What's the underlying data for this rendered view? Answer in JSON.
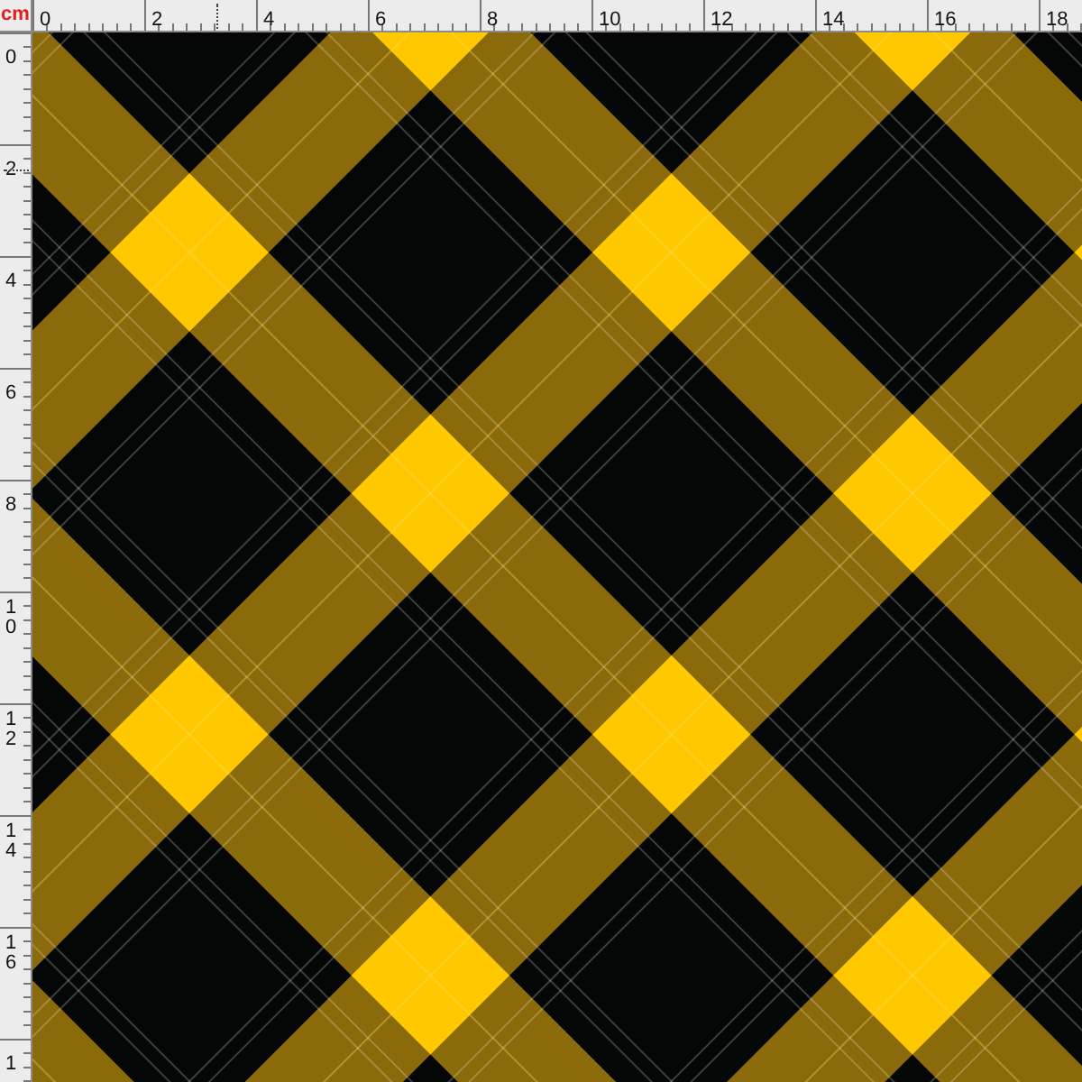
{
  "ruler_unit": "cm",
  "top_ruler": {
    "labels": [
      "0",
      "2",
      "4",
      "6",
      "8",
      "10",
      "12",
      "14",
      "16",
      "18"
    ]
  },
  "left_ruler": {
    "labels": [
      "0",
      "2",
      "4",
      "6",
      "8",
      "10",
      "12",
      "14",
      "16",
      "1"
    ]
  }
}
